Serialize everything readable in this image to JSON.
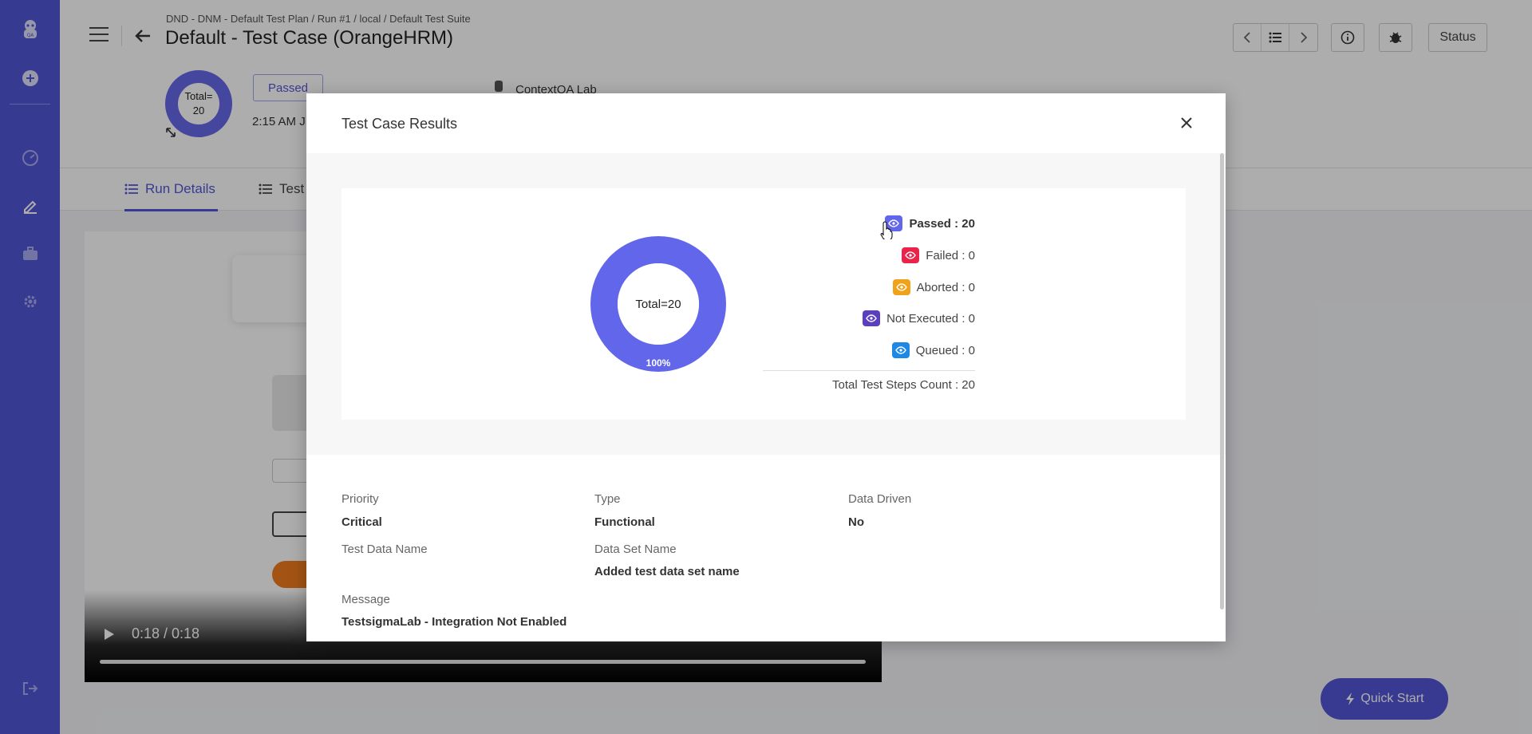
{
  "header": {
    "breadcrumb": "DND - DNM - Default Test Plan / Run #1 / local / Default Test Suite",
    "title": "Default - Test Case (OrangeHRM)",
    "ring_line1": "Total=",
    "ring_line2": "20",
    "status_pill": "Passed",
    "time_partial": "2:15 AM J",
    "lab_name": "ContextQA Lab",
    "status_button": "Status"
  },
  "tabs": [
    {
      "label": "Run Details"
    },
    {
      "label": "Test"
    }
  ],
  "video": {
    "time": "0:18 / 0:18"
  },
  "quick_start": "Quick Start",
  "modal": {
    "title": "Test Case Results",
    "donut_center": "Total=20",
    "donut_percent": "100%",
    "legend": [
      {
        "label": "Passed : 20",
        "color": "#6266ea",
        "value": 20
      },
      {
        "label": "Failed : 0",
        "color": "#e8244a",
        "value": 0
      },
      {
        "label": "Aborted : 0",
        "color": "#f0a21b",
        "value": 0
      },
      {
        "label": "Not Executed : 0",
        "color": "#5a3fc0",
        "value": 0
      },
      {
        "label": "Queued : 0",
        "color": "#1e88e5",
        "value": 0
      }
    ],
    "total_steps": "Total Test Steps Count : 20",
    "fields": {
      "priority_label": "Priority",
      "priority_value": "Critical",
      "type_label": "Type",
      "type_value": "Functional",
      "data_driven_label": "Data Driven",
      "data_driven_value": "No",
      "test_data_name_label": "Test Data Name",
      "data_set_name_label": "Data Set Name",
      "data_set_name_value": "Added test data set name",
      "message_label": "Message",
      "message_value": "TestsigmaLab - Integration Not Enabled"
    }
  },
  "colors": {
    "brand": "#5356d7",
    "passed": "#6266ea"
  }
}
